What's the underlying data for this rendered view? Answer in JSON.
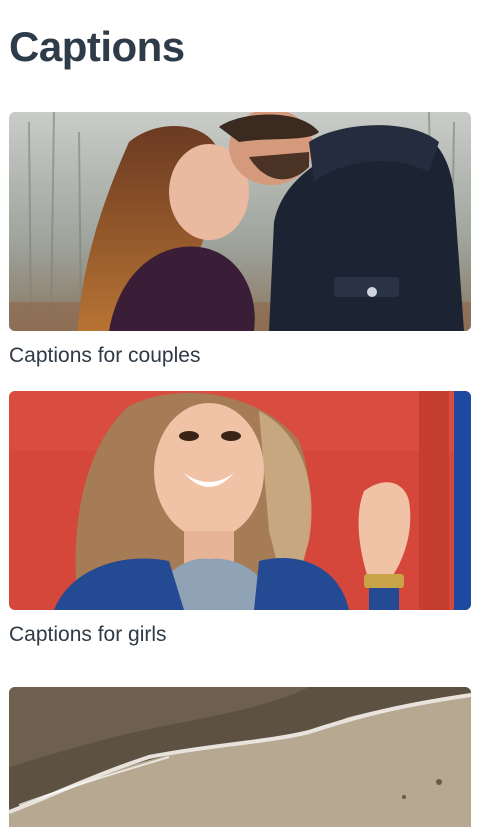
{
  "header": {
    "title": "Captions"
  },
  "cards": [
    {
      "label": "Captions for couples",
      "image": "couple-photo"
    },
    {
      "label": "Captions for girls",
      "image": "girl-photo"
    },
    {
      "label": "",
      "image": "beach-photo"
    }
  ],
  "colors": {
    "title": "#2e3b49",
    "label": "#2f3a45",
    "background": "#ffffff",
    "accent_red": "#d5473a",
    "accent_blue": "#1d4aa0"
  }
}
